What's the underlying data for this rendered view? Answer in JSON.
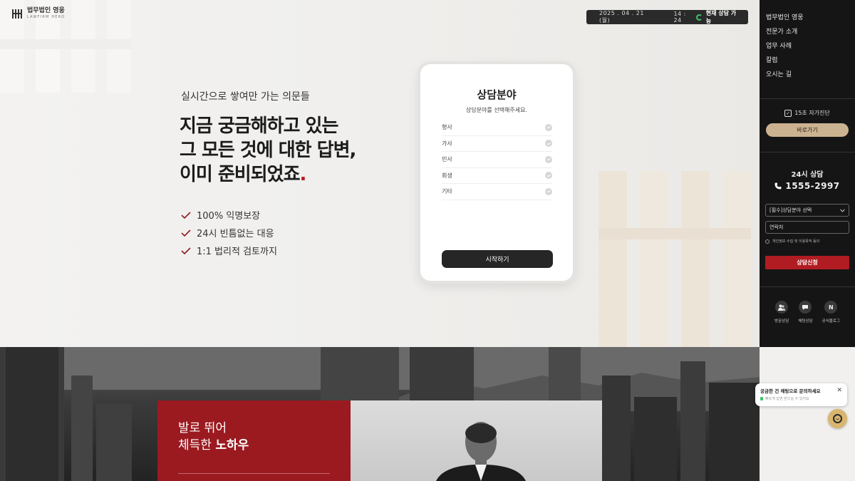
{
  "brand": {
    "name_ko": "법무법인 영웅",
    "name_en": "LAWFIRM HERO"
  },
  "datebar": {
    "date": "2025 . 04 . 21 (월)",
    "time": "14 : 24",
    "status": "현재 상담 가능"
  },
  "hero": {
    "eyebrow": "실시간으로 쌓여만 가는 의문들",
    "headline_1": "지금 궁금해하고 있는",
    "headline_2": "그 모든 것에 대한 답변,",
    "headline_3": "이미 준비되었죠",
    "headline_dot": ".",
    "checks": [
      "100% 익명보장",
      "24시 빈틈없는 대응",
      "1:1 법리적 검토까지"
    ]
  },
  "card": {
    "title": "상담분야",
    "subtitle": "상담분야를 선택해주세요.",
    "options": [
      "형사",
      "가사",
      "민사",
      "회생",
      "기타"
    ],
    "start_label": "시작하기"
  },
  "sidebar": {
    "nav": [
      "법무법인 영웅",
      "전문가 소개",
      "업무 사례",
      "칼럼",
      "오시는 길"
    ],
    "selfcheck_label": "15초 자가진단",
    "goto_label": "바로가기",
    "cs_title": "24시 상담",
    "cs_phone": "1555-2997",
    "select_value": "[필수]상담분야 선택",
    "phone_placeholder": "연락처",
    "agree_label": "개인정보 수집 및 이용목적 동의",
    "apply_label": "상담신청",
    "quick": [
      {
        "label": "방문상담",
        "icon": "people-icon"
      },
      {
        "label": "채팅상담",
        "icon": "chat-icon"
      },
      {
        "label": "공식블로그",
        "icon": "naver-icon",
        "glyph": "N"
      }
    ]
  },
  "knowhow": {
    "line1": "발로 뛰어",
    "line2_prefix": "체득한 ",
    "line2_bold": "노하우"
  },
  "chat": {
    "title": "궁금한 건 채팅으로 문의하세요",
    "subtitle": "빠르게 답변 받으실 수 있어요",
    "close": "✕"
  },
  "colors": {
    "accent_red": "#b11c22",
    "gold": "#cbb391",
    "sidebar_bg": "#151515",
    "online_green": "#3ec46d"
  }
}
